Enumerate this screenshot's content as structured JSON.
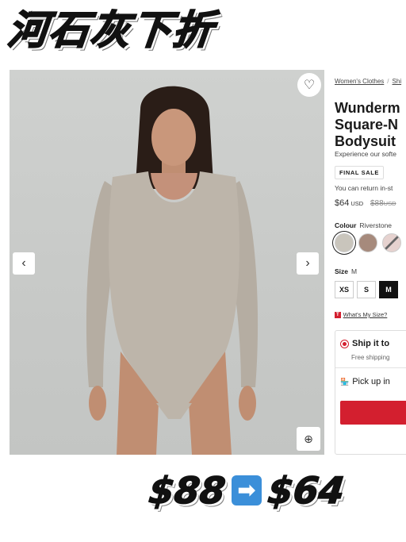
{
  "banner": {
    "text": "河石灰下折"
  },
  "product": {
    "breadcrumb": [
      "Women's Clothes",
      "Shi"
    ],
    "title_lines": [
      "Wunderm",
      "Square-N",
      "Bodysuit"
    ],
    "description": "Experience our softe",
    "badge": "FINAL SALE",
    "return_note": "You can return in-st",
    "price": {
      "current": "$64",
      "current_currency": "USD",
      "original": "$88",
      "original_currency": "USD"
    },
    "colour": {
      "label": "Colour",
      "value": "Riverstone"
    },
    "swatch_colors": [
      "#c9c5bc",
      "#a68a7c",
      "#e6d2cf"
    ],
    "size": {
      "label": "Size",
      "value": "M",
      "options": [
        "XS",
        "S",
        "M"
      ]
    },
    "whats_my_size": "What's My Size?",
    "shipping": {
      "title": "Ship it to",
      "subtitle": "Free shipping"
    },
    "pickup": {
      "title": "Pick up in"
    }
  },
  "deal": {
    "was": "$88",
    "arrow": "➡",
    "now": "$64"
  },
  "colors": {
    "accent_red": "#d31f2f",
    "photo_bg": "#cacccb",
    "arrow_blue": "#3b8fd9"
  }
}
